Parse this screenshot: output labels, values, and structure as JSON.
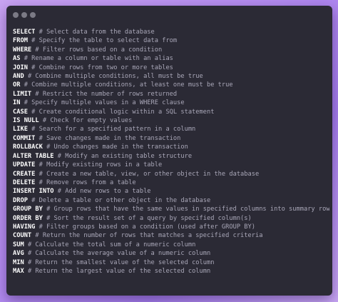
{
  "window": {
    "controls": [
      "close",
      "minimize",
      "maximize"
    ]
  },
  "lines": [
    {
      "keyword": "SELECT",
      "comment": "# Select data from the database"
    },
    {
      "keyword": "FROM",
      "comment": "# Specify the table to select data from"
    },
    {
      "keyword": "WHERE",
      "comment": "# Filter rows based on a condition"
    },
    {
      "keyword": "AS",
      "comment": "# Rename a column or table with an alias"
    },
    {
      "keyword": "JOIN",
      "comment": "# Combine rows from two or more tables"
    },
    {
      "keyword": "AND",
      "comment": "# Combine multiple conditions, all must be true"
    },
    {
      "keyword": "OR",
      "comment": "# Combine multiple conditions, at least one must be true"
    },
    {
      "keyword": "LIMIT",
      "comment": "# Restrict the number of rows returned"
    },
    {
      "keyword": "IN",
      "comment": "# Specify multiple values in a WHERE clause"
    },
    {
      "keyword": "CASE",
      "comment": "# Create conditional logic within a SQL statement"
    },
    {
      "keyword": "IS NULL",
      "comment": "# Check for empty values"
    },
    {
      "keyword": "LIKE",
      "comment": "# Search for a specified pattern in a column"
    },
    {
      "keyword": "COMMIT",
      "comment": "# Save changes made in the transaction"
    },
    {
      "keyword": "ROLLBACK",
      "comment": "# Undo changes made in the transaction"
    },
    {
      "keyword": "ALTER TABLE",
      "comment": "# Modify an existing table structure"
    },
    {
      "keyword": "UPDATE",
      "comment": "# Modify existing rows in a table"
    },
    {
      "keyword": "CREATE",
      "comment": "# Create a new table, view, or other object in the database"
    },
    {
      "keyword": "DELETE",
      "comment": "# Remove rows from a table"
    },
    {
      "keyword": "INSERT INTO",
      "comment": "# Add new rows to a table"
    },
    {
      "keyword": "DROP",
      "comment": "# Delete a table or other object in the database"
    },
    {
      "keyword": "GROUP BY",
      "comment": "# Group rows that have the same values in specified columns into summary rows"
    },
    {
      "keyword": "ORDER BY",
      "comment": "# Sort the result set of a query by specified column(s)"
    },
    {
      "keyword": "HAVING",
      "comment": "# Filter groups based on a condition (used after GROUP BY)"
    },
    {
      "keyword": "COUNT",
      "comment": "# Return the number of rows that matches a specified criteria"
    },
    {
      "keyword": "SUM",
      "comment": "# Calculate the total sum of a numeric column"
    },
    {
      "keyword": "AVG",
      "comment": "# Calculate the average value of a numeric column"
    },
    {
      "keyword": "MIN",
      "comment": "# Return the smallest value of the selected column"
    },
    {
      "keyword": "MAX",
      "comment": "# Return the largest value of the selected column"
    }
  ]
}
